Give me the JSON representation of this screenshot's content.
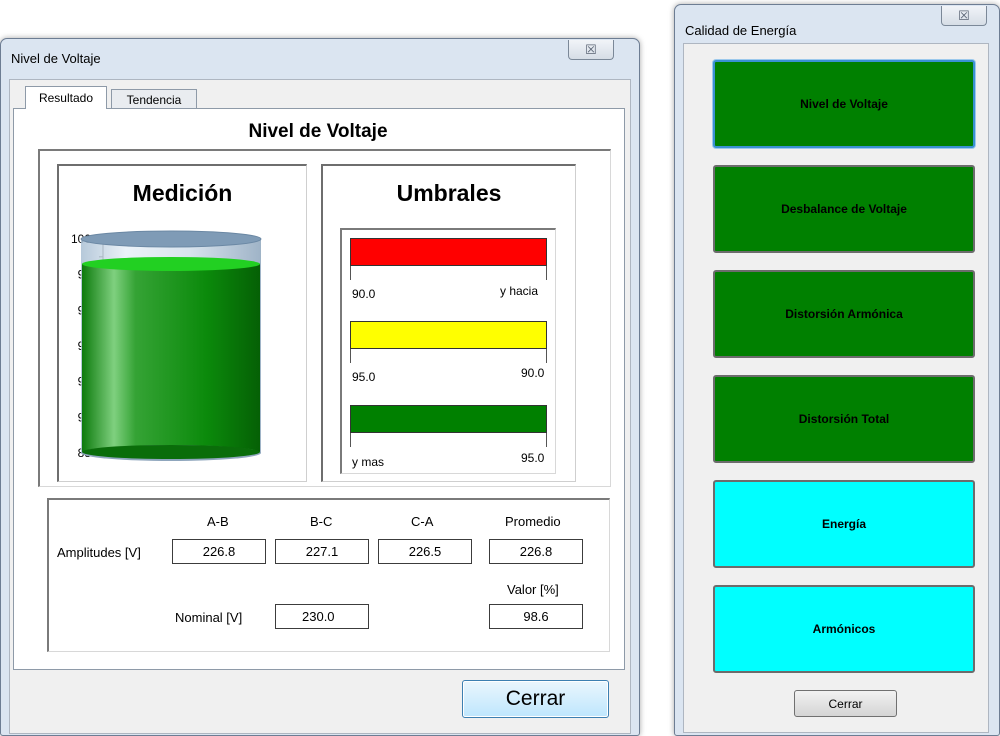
{
  "voltage_window": {
    "title": "Nivel de Voltaje",
    "close_glyph": "☒",
    "tabs": [
      {
        "label": "Resultado",
        "active": true
      },
      {
        "label": "Tendencia",
        "active": false
      }
    ],
    "page_title": "Nivel de Voltaje",
    "medicion": {
      "heading": "Medición",
      "gauge_value_pct": 98.6,
      "axis_range": [
        88,
        100
      ],
      "ticks": [
        "100",
        "98",
        "96",
        "94",
        "92",
        "90",
        "88"
      ],
      "liquid_color": "#008000"
    },
    "umbrales": {
      "heading": "Umbrales",
      "bands": [
        {
          "color": "#ff0000",
          "left_label": "90.0",
          "right_label": "y hacia"
        },
        {
          "color": "#ffff00",
          "left_label": "95.0",
          "right_label": "90.0"
        },
        {
          "color": "#008000",
          "left_label": "y mas",
          "right_label": "95.0"
        }
      ]
    },
    "table": {
      "columns": [
        "A-B",
        "B-C",
        "C-A",
        "Promedio"
      ],
      "amplitudes_label": "Amplitudes [V]",
      "amplitudes": [
        "226.8",
        "227.1",
        "226.5",
        "226.8"
      ],
      "valor_label": "Valor [%]",
      "nominal_label": "Nominal [V]",
      "nominal": "230.0",
      "valor": "98.6"
    },
    "close_button": "Cerrar"
  },
  "quality_window": {
    "title": "Calidad de Energía",
    "close_glyph": "☒",
    "buttons": [
      {
        "label": "Nivel de Voltaje",
        "color": "#008000"
      },
      {
        "label": "Desbalance de Voltaje",
        "color": "#008000"
      },
      {
        "label": "Distorsión Armónica",
        "color": "#008000"
      },
      {
        "label": "Distorsión Total",
        "color": "#008000"
      },
      {
        "label": "Energía",
        "color": "#00ffff"
      },
      {
        "label": "Armónicos",
        "color": "#00ffff"
      }
    ],
    "close_button": "Cerrar"
  }
}
